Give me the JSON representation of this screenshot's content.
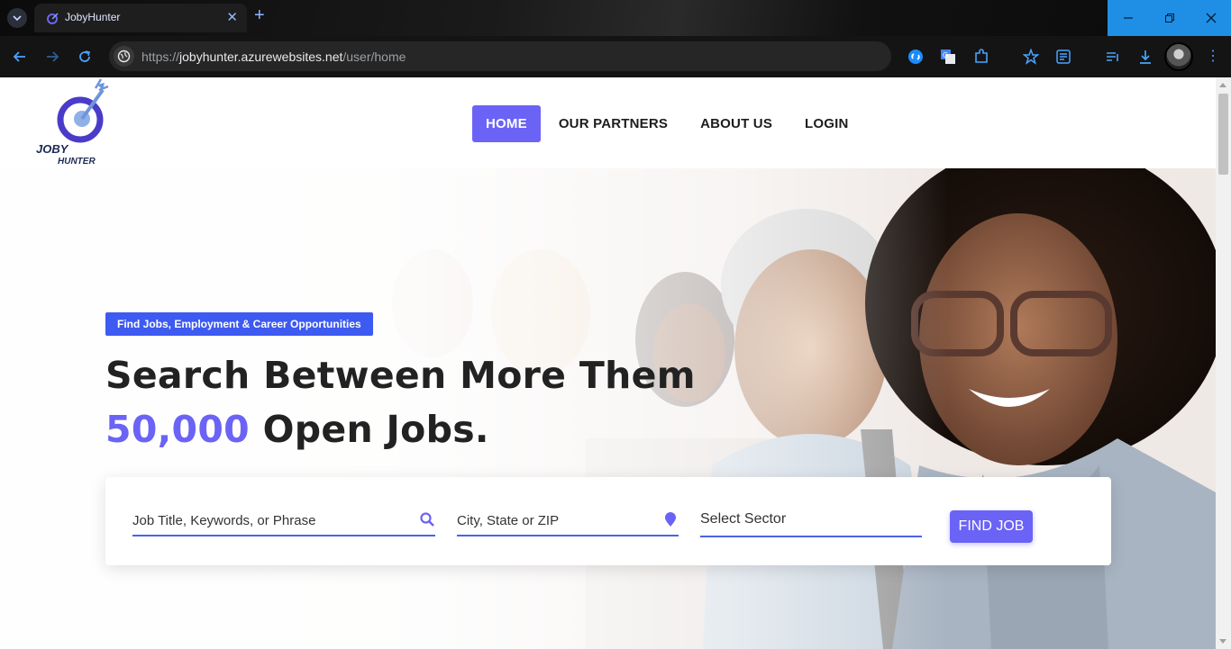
{
  "browser": {
    "tab_title": "JobyHunter",
    "tab_close": "✕",
    "new_tab": "+",
    "url_scheme": "https://",
    "url_host": "jobyhunter.azurewebsites.net",
    "url_path": "/user/home",
    "accent_color": "#4aa3ff"
  },
  "site": {
    "logo_text_1": "JOBY",
    "logo_text_2": "HUNTER",
    "menu": [
      {
        "label": "HOME",
        "active": true
      },
      {
        "label": "OUR PARTNERS",
        "active": false
      },
      {
        "label": "ABOUT US",
        "active": false
      },
      {
        "label": "LOGIN",
        "active": false
      }
    ],
    "brand_color": "#6b63f5"
  },
  "hero": {
    "tagline": "Find Jobs, Employment & Career Opportunities",
    "headline_line1": "Search Between More Them",
    "headline_accent": "50,000",
    "headline_rest": " Open Jobs."
  },
  "search": {
    "keywords_placeholder": "Job Title, Keywords, or Phrase",
    "location_placeholder": "City, State or ZIP",
    "sector_label": "Select Sector",
    "button_label": "FIND JOB"
  }
}
